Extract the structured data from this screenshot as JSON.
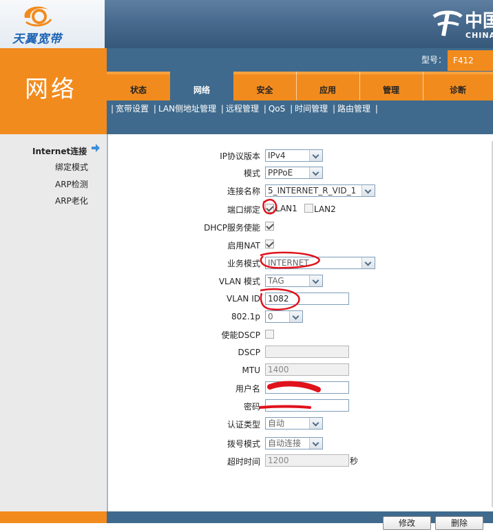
{
  "brand": {
    "logo_text": "天翼宽带",
    "telecom_cn": "中国",
    "telecom_en": "CHINA"
  },
  "model": {
    "label": "型号：",
    "value": "F412"
  },
  "section_title": "网络",
  "tabs": [
    {
      "label": "状态",
      "active": false
    },
    {
      "label": "网络",
      "active": true
    },
    {
      "label": "安全",
      "active": false
    },
    {
      "label": "应用",
      "active": false
    },
    {
      "label": "管理",
      "active": false
    },
    {
      "label": "诊断",
      "active": false
    }
  ],
  "subnav": [
    "宽带设置",
    "LAN侧地址管理",
    "远程管理",
    "QoS",
    "时间管理",
    "路由管理"
  ],
  "left_menu": [
    {
      "label": "Internet连接",
      "active": true
    },
    {
      "label": "绑定模式",
      "active": false
    },
    {
      "label": "ARP检测",
      "active": false
    },
    {
      "label": "ARP老化",
      "active": false
    }
  ],
  "form": {
    "ip_version": {
      "label": "IP协议版本",
      "value": "IPv4"
    },
    "mode": {
      "label": "模式",
      "value": "PPPoE"
    },
    "connection_name": {
      "label": "连接名称",
      "value": "5_INTERNET_R_VID_1"
    },
    "port_binding": {
      "label": "端口绑定",
      "lan1": "LAN1",
      "lan1_checked": true,
      "lan2": "LAN2",
      "lan2_checked": false
    },
    "dhcp_enable": {
      "label": "DHCP服务使能",
      "checked": true
    },
    "nat_enable": {
      "label": "启用NAT",
      "checked": true
    },
    "service_mode": {
      "label": "业务模式",
      "value": "INTERNET"
    },
    "vlan_mode": {
      "label": "VLAN 模式",
      "value": "TAG"
    },
    "vlan_id": {
      "label": "VLAN ID",
      "value": "1082"
    },
    "priority": {
      "label": "802.1p",
      "value": "0"
    },
    "dscp_enable": {
      "label": "使能DSCP",
      "checked": false
    },
    "dscp": {
      "label": "DSCP",
      "value": ""
    },
    "mtu": {
      "label": "MTU",
      "value": "1400"
    },
    "username": {
      "label": "用户名",
      "value": ""
    },
    "password": {
      "label": "密码",
      "value": ""
    },
    "auth_type": {
      "label": "认证类型",
      "value": "自动"
    },
    "dial_mode": {
      "label": "拨号模式",
      "value": "自动连接"
    },
    "idle_timeout": {
      "label": "超时时间",
      "value": "1200",
      "unit": "秒"
    }
  },
  "buttons": {
    "modify": "修改",
    "delete": "删除"
  },
  "colors": {
    "orange": "#f28b1d",
    "blue": "#3f6a8d",
    "annotation_red": "#e0121b"
  }
}
